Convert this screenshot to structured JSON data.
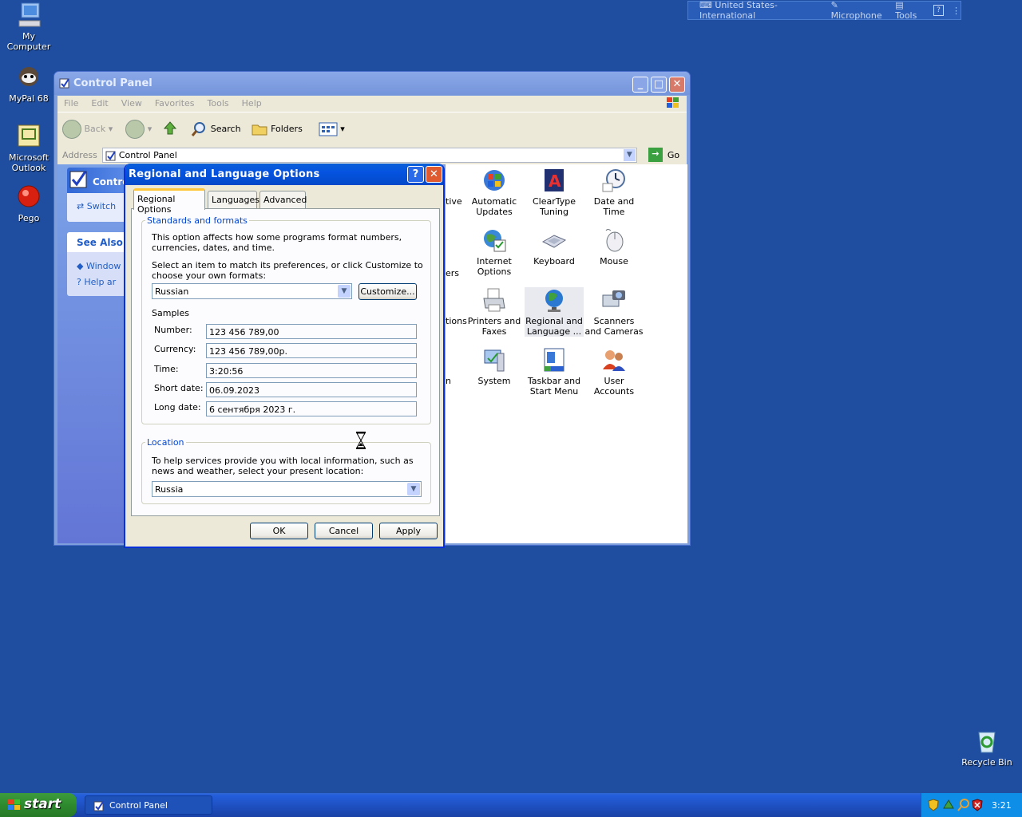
{
  "desktop": {
    "icons": [
      {
        "label": "My Computer"
      },
      {
        "label": "MyPal 68"
      },
      {
        "label": "Microsoft Outlook"
      },
      {
        "label": "Pego"
      },
      {
        "label": "Recycle Bin"
      }
    ]
  },
  "langbar": {
    "language": "United States-International",
    "microphone": "Microphone",
    "tools": "Tools",
    "help": "?"
  },
  "control_panel": {
    "title": "Control Panel",
    "menu": [
      "File",
      "Edit",
      "View",
      "Favorites",
      "Tools",
      "Help"
    ],
    "toolbar": {
      "back": "Back",
      "search": "Search",
      "folders": "Folders"
    },
    "address_label": "Address",
    "address_value": "Control Panel",
    "go": "Go",
    "side": {
      "header": "Contro",
      "switch": "Switch",
      "see_also": "See Also",
      "see_also_items": [
        "Window",
        "Help ar"
      ]
    },
    "partial_labels": [
      "tive",
      "ers",
      "tions",
      "n"
    ],
    "items": [
      {
        "label": "Automatic Updates",
        "icon": "windows-update-icon"
      },
      {
        "label": "ClearType Tuning",
        "icon": "cleartype-icon"
      },
      {
        "label": "Date and Time",
        "icon": "clock-icon"
      },
      {
        "label": "Internet Options",
        "icon": "globe-options-icon"
      },
      {
        "label": "Keyboard",
        "icon": "keyboard-icon"
      },
      {
        "label": "Mouse",
        "icon": "mouse-icon"
      },
      {
        "label": "Printers and Faxes",
        "icon": "printer-icon"
      },
      {
        "label": "Regional and Language ...",
        "icon": "globe-icon"
      },
      {
        "label": "Scanners and Cameras",
        "icon": "scanner-icon"
      },
      {
        "label": "System",
        "icon": "system-icon"
      },
      {
        "label": "Taskbar and Start Menu",
        "icon": "taskbar-icon"
      },
      {
        "label": "User Accounts",
        "icon": "users-icon"
      }
    ]
  },
  "dialog": {
    "title": "Regional and Language Options",
    "help_btn": "?",
    "tabs": [
      "Regional Options",
      "Languages",
      "Advanced"
    ],
    "standards": {
      "legend": "Standards and formats",
      "desc": "This option affects how some programs format numbers, currencies, dates, and time.",
      "select_desc": "Select an item to match its preferences, or click Customize to choose your own formats:",
      "selected": "Russian",
      "customize": "Customize...",
      "samples_label": "Samples",
      "samples": [
        {
          "label": "Number:",
          "value": "123 456 789,00"
        },
        {
          "label": "Currency:",
          "value": "123 456 789,00р."
        },
        {
          "label": "Time:",
          "value": "3:20:56"
        },
        {
          "label": "Short date:",
          "value": "06.09.2023"
        },
        {
          "label": "Long date:",
          "value": "6 сентября 2023 г."
        }
      ]
    },
    "location": {
      "legend": "Location",
      "desc": "To help services provide you with local information, such as news and weather, select your present location:",
      "selected": "Russia"
    },
    "buttons": {
      "ok": "OK",
      "cancel": "Cancel",
      "apply": "Apply"
    }
  },
  "taskbar": {
    "start": "start",
    "task": "Control Panel",
    "clock": "3:21"
  }
}
